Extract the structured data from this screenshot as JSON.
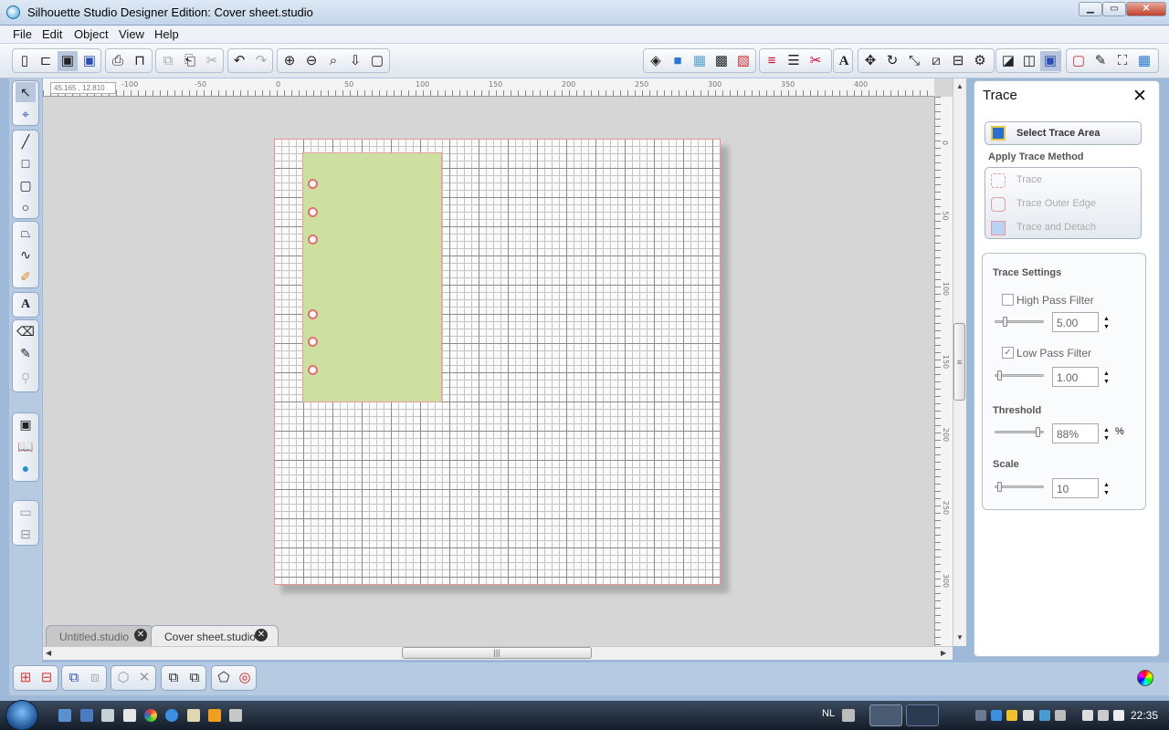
{
  "window": {
    "title": "Silhouette Studio Designer Edition: Cover sheet.studio",
    "min_btn": "▁",
    "max_btn": "▭",
    "close_btn": "✕"
  },
  "menu": [
    "File",
    "Edit",
    "Object",
    "View",
    "Help"
  ],
  "rulers": {
    "coordinates": "45.165 , 12.810",
    "horizontal_labels": [
      "-100",
      "-50",
      "0",
      "50",
      "100",
      "150",
      "200",
      "250",
      "300",
      "350",
      "400"
    ],
    "vertical_labels": [
      "0",
      "50",
      "100",
      "150",
      "200",
      "250",
      "300"
    ]
  },
  "tabs": [
    {
      "label": "Untitled.studio",
      "active": false
    },
    {
      "label": "Cover sheet.studio",
      "active": true
    }
  ],
  "trace_panel": {
    "title": "Trace",
    "close": "✕",
    "select_area": "Select Trace Area",
    "apply_method_heading": "Apply Trace Method",
    "methods": [
      "Trace",
      "Trace Outer Edge",
      "Trace and Detach"
    ],
    "settings_heading": "Trace Settings",
    "high_pass": {
      "label": "High Pass Filter",
      "checked": false,
      "value": "5.00"
    },
    "low_pass": {
      "label": "Low Pass Filter",
      "checked": true,
      "value": "1.00"
    },
    "threshold": {
      "label": "Threshold",
      "value": "88%",
      "unit": "%",
      "level": 0.88
    },
    "scale": {
      "label": "Scale",
      "value": "10"
    }
  },
  "design": {
    "shape_color": "#cde0a2",
    "hole_count": 6
  },
  "taskbar": {
    "language": "NL",
    "clock": "22:35"
  },
  "icons": {
    "new": "📄",
    "open": "📂",
    "save": "💾",
    "print": "🖨",
    "undo": "↶",
    "redo": "↷",
    "zoom_in": "🔍",
    "text": "A"
  }
}
